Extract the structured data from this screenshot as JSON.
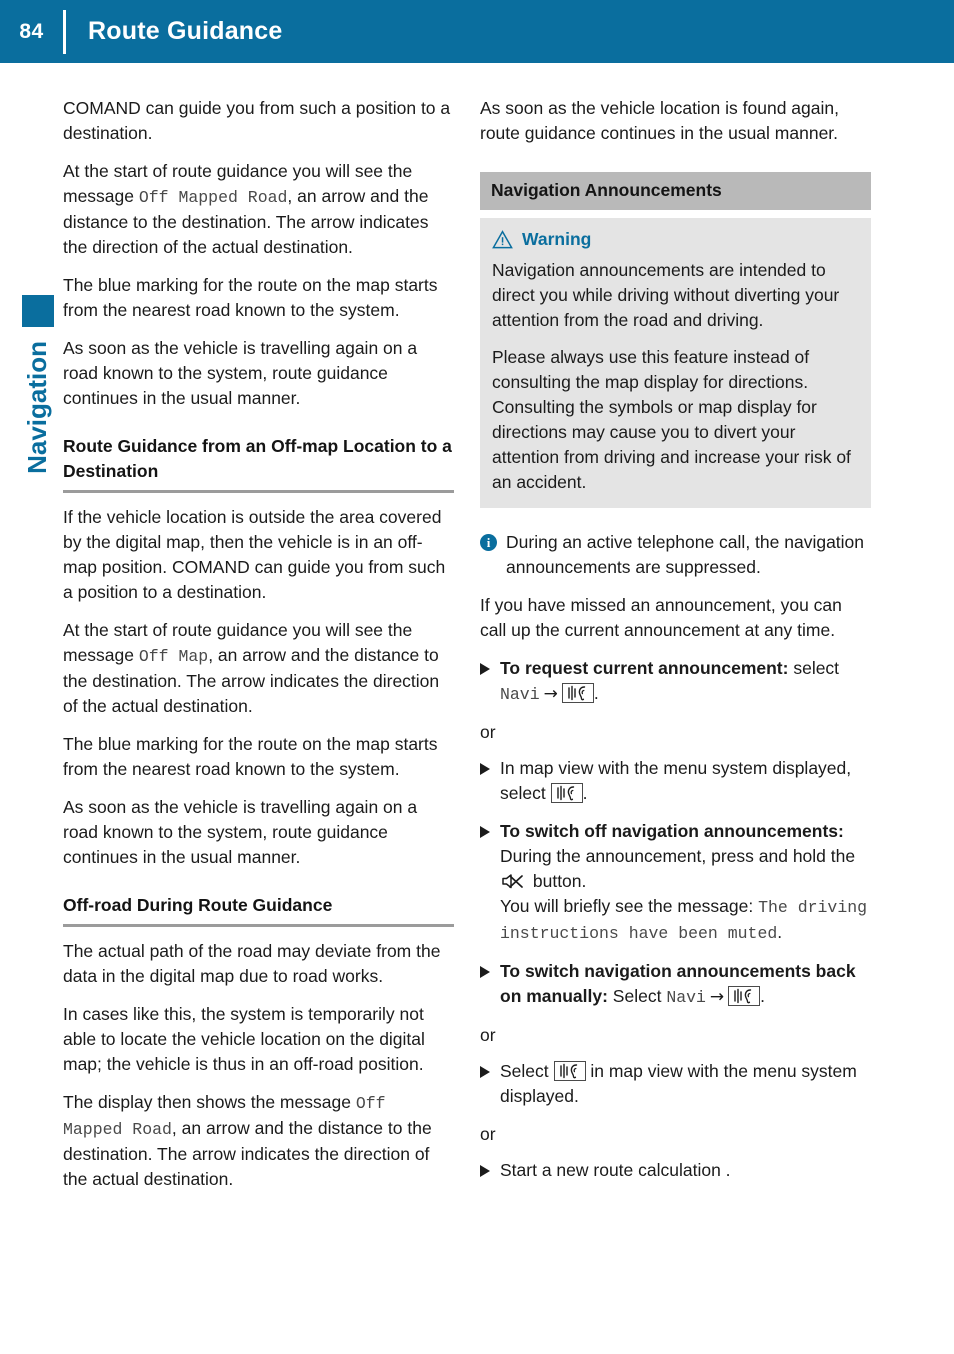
{
  "header": {
    "page_number": "84",
    "title": "Route Guidance",
    "accent_color": "#0a6e9e"
  },
  "side_tab": {
    "label": "Navigation"
  },
  "left_column": {
    "p1": "COMAND can guide you from such a position to a destination.",
    "p2_a": "At the start of route guidance you will see the message ",
    "p2_mono": "Off Mapped Road",
    "p2_b": ", an arrow and the distance to the destination. The arrow indicates the direction of the actual destination.",
    "p3": "The blue marking for the route on the map starts from the nearest road known to the system.",
    "p4": "As soon as the vehicle is travelling again on a road known to the system, route guidance continues in the usual manner.",
    "heading1": "Route Guidance from an Off-map Location to a Destination",
    "p5": "If the vehicle location is outside the area covered by the digital map, then the vehicle is in an off-map position. COMAND can guide you from such a position to a destination.",
    "p6_a": "At the start of route guidance you will see the message ",
    "p6_mono": "Off Map",
    "p6_b": ", an arrow and the distance to the destination. The arrow indicates the direction of the actual destination.",
    "p7": "The blue marking for the route on the map starts from the nearest road known to the system.",
    "p8": "As soon as the vehicle is travelling again on a road known to the system, route guidance continues in the usual manner.",
    "heading2": "Off-road During Route Guidance",
    "p9": "The actual path of the road may deviate from the data in the digital map due to road works.",
    "p10": "In cases like this, the system is temporarily not able to locate the vehicle location on the digital map; the vehicle is thus in an off-road position.",
    "p11_a": "The display then shows the message ",
    "p11_mono": "Off Mapped Road",
    "p11_b": ", an arrow and the distance to the destination. The arrow indicates the direction of the actual destination."
  },
  "right_column": {
    "p1": "As soon as the vehicle location is found again, route guidance continues in the usual manner.",
    "section_title": "Navigation Announcements",
    "warning": {
      "title": "Warning",
      "p1": "Navigation announcements are intended to direct you while driving without diverting your attention from the road and driving.",
      "p2": "Please always use this feature instead of consulting the map display for directions. Consulting the symbols or map display for directions may cause you to divert your attention from driving and increase your risk of an accident."
    },
    "info_note": "During an active telephone call, the navigation announcements are suppressed.",
    "p2": "If you have missed an announcement, you can call up the current announcement at any time.",
    "action1": {
      "bold": "To request current announcement:",
      "text_a": " select ",
      "mono": "Navi",
      "arrow": "→",
      "text_b": "."
    },
    "or1": "or",
    "action2": {
      "text_a": "In map view with the menu system displayed, select ",
      "text_b": "."
    },
    "action3": {
      "bold": "To switch off navigation announcements:",
      "text_a": " During the announcement, press and hold the ",
      "text_b": " button.",
      "text_c": "You will briefly see the message: ",
      "mono": "The driving instructions have been muted",
      "text_d": "."
    },
    "action4": {
      "bold": "To switch navigation announcements back on manually:",
      "text_a": " Select ",
      "mono": "Navi",
      "arrow": "→",
      "text_b": "."
    },
    "or2": "or",
    "action5": {
      "text_a": "Select ",
      "text_b": " in map view with the menu system displayed."
    },
    "or3": "or",
    "action6": {
      "text_a": "Start a new route calculation ."
    }
  },
  "icons": {
    "warning_triangle": "warning-triangle-icon",
    "info": "i",
    "audio_announcement": "audio-announcement-icon",
    "mute": "mute-icon"
  }
}
